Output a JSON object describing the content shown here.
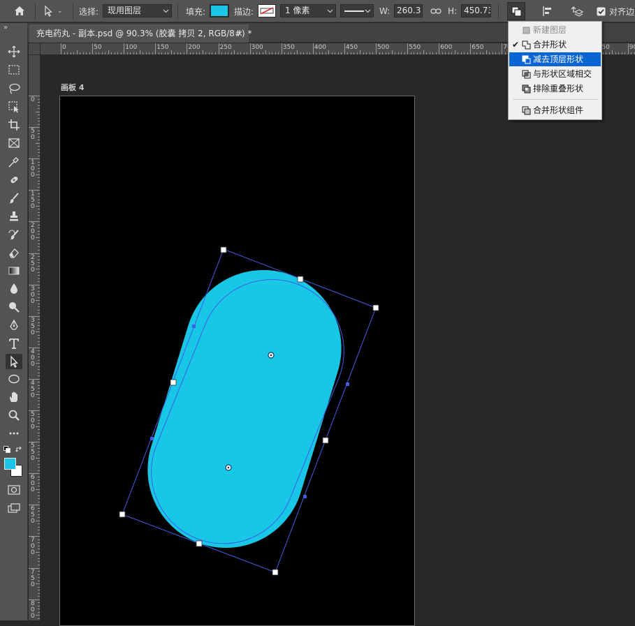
{
  "options_bar": {
    "select_label": "选择:",
    "select_value": "现用图层",
    "fill_label": "填充:",
    "fill_color": "#1bc5e7",
    "stroke_label": "描边:",
    "stroke_width": "1 像素",
    "w_label": "W:",
    "w_value": "260.3 ",
    "h_label": "H:",
    "h_value": "450.73",
    "align_edges_label": "对齐边"
  },
  "document_tab": {
    "title": "充电药丸 - 副本.psd @ 90.3% (胶囊 拷贝 2, RGB/8#) *",
    "close": "×"
  },
  "rulers": {
    "horizontal": [
      "0",
      "50",
      "100",
      "150",
      "200",
      "250",
      "300",
      "350",
      "400",
      "450",
      "500",
      "550",
      "600",
      "650",
      "700",
      "750",
      "800",
      "850",
      "90"
    ],
    "vertical": [
      "0",
      "50",
      "100",
      "150",
      "200",
      "250",
      "300",
      "350",
      "400",
      "450",
      "500",
      "550",
      "600",
      "650",
      "700",
      "750",
      "800"
    ]
  },
  "artboard": {
    "label": "画板 4"
  },
  "shape": {
    "fill_color": "#18c6e6",
    "path_color": "#3f5ee6"
  },
  "path_operations_menu": {
    "items": [
      {
        "label": "新建图层",
        "state": "disabled",
        "icon": "new-layer-icon"
      },
      {
        "label": "合并形状",
        "state": "checked",
        "icon": "combine-shapes-icon"
      },
      {
        "label": "减去顶层形状",
        "state": "highlighted",
        "icon": "subtract-front-shape-icon"
      },
      {
        "label": "与形状区域相交",
        "state": "normal",
        "icon": "intersect-shape-areas-icon"
      },
      {
        "label": "排除重叠形状",
        "state": "normal",
        "icon": "exclude-overlapping-shapes-icon"
      },
      {
        "label": "合并形状组件",
        "state": "normal",
        "icon": "merge-shape-components-icon"
      }
    ],
    "check_mark": "✔"
  },
  "toolbar": {
    "tools": [
      "move-tool",
      "marquee-tool",
      "lasso-tool",
      "object-select-tool",
      "crop-tool",
      "frame-tool",
      "eyedropper-tool",
      "healing-brush-tool",
      "brush-tool",
      "stamp-tool",
      "history-brush-tool",
      "eraser-tool",
      "gradient-tool",
      "blur-tool",
      "dodge-tool",
      "pen-tool",
      "type-tool",
      "direct-selection-tool",
      "ellipse-tool",
      "hand-tool",
      "zoom-tool",
      "more-tools"
    ],
    "active_tool": "direct-selection-tool",
    "foreground_color": "#1bc5e7",
    "background_color": "#ffffff",
    "expand_glyph": "»"
  }
}
